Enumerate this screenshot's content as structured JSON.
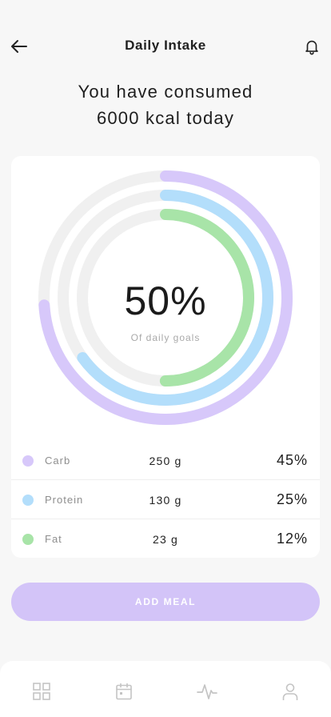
{
  "header": {
    "title": "Daily Intake",
    "back_icon": "arrow-left-icon",
    "notification_icon": "bell-icon"
  },
  "headline": {
    "line1": "You have consumed",
    "line2": "6000 kcal today"
  },
  "summary": {
    "center_value": "50%",
    "center_label": "Of daily goals"
  },
  "macros": [
    {
      "name": "Carb",
      "amount": "250 g",
      "percent": "45%",
      "color": "#d7c8fa"
    },
    {
      "name": "Protein",
      "amount": "130 g",
      "percent": "25%",
      "color": "#b3defb"
    },
    {
      "name": "Fat",
      "amount": "23 g",
      "percent": "12%",
      "color": "#a8e4a8"
    }
  ],
  "rings": [
    {
      "name": "Carb",
      "progress": 0.74,
      "color": "#d7c8fa"
    },
    {
      "name": "Protein",
      "progress": 0.65,
      "color": "#b3defb"
    },
    {
      "name": "Fat",
      "progress": 0.5,
      "color": "#a8e4a8"
    }
  ],
  "track_color": "#f0f0f0",
  "actions": {
    "add_meal_label": "ADD MEAL",
    "add_meal_color": "#d3c4f8"
  },
  "nav": [
    {
      "name": "dashboard",
      "icon": "grid-icon"
    },
    {
      "name": "calendar",
      "icon": "calendar-icon"
    },
    {
      "name": "activity",
      "icon": "activity-icon"
    },
    {
      "name": "profile",
      "icon": "user-icon"
    }
  ]
}
